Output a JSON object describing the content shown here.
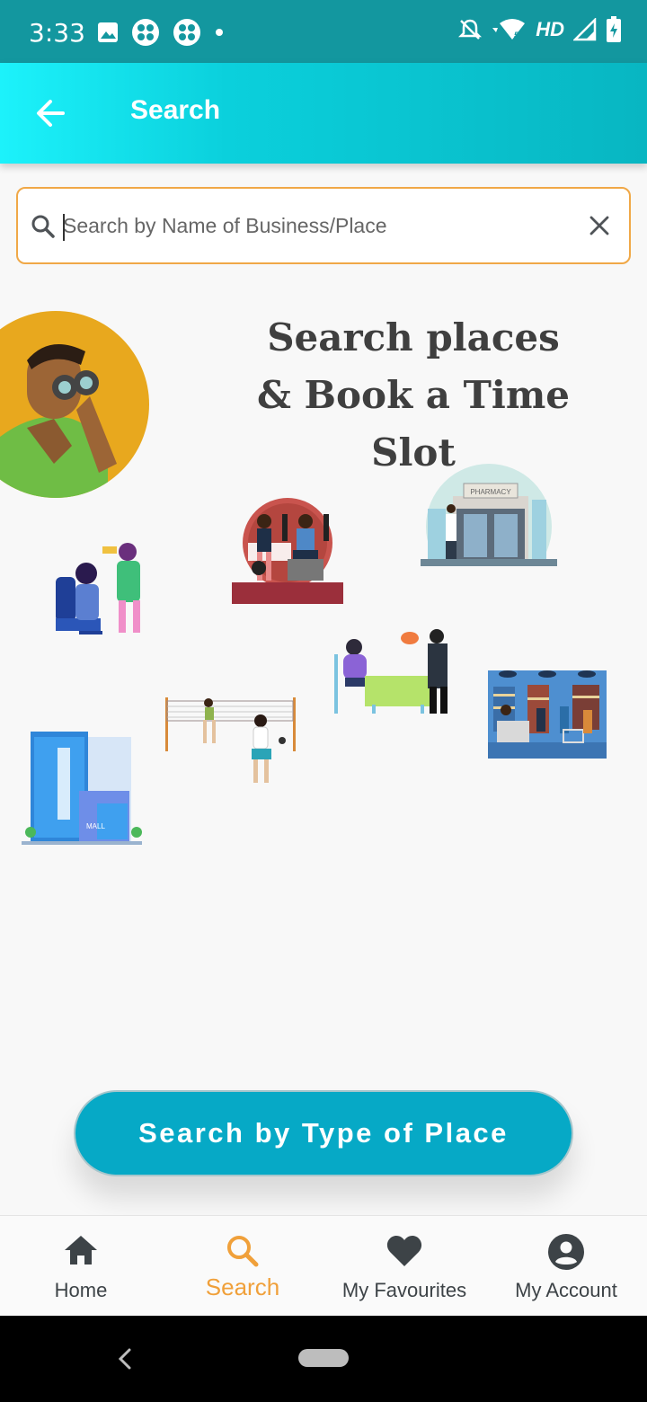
{
  "status_bar": {
    "time": "3:33",
    "network_label": "HD"
  },
  "app_bar": {
    "title": "Search"
  },
  "search": {
    "placeholder": "Search by Name of Business/Place",
    "value": ""
  },
  "headline": {
    "line1": "Search places",
    "line2": "& Book a Time Slot"
  },
  "illustrations": {
    "pharmacy_sign": "PHARMACY",
    "mall_sign": "MALL"
  },
  "action_button": {
    "label": "Search by Type of Place"
  },
  "bottom_nav": {
    "items": [
      {
        "label": "Home",
        "icon": "home-icon",
        "active": false
      },
      {
        "label": "Search",
        "icon": "search-icon",
        "active": true
      },
      {
        "label": "My Favourites",
        "icon": "heart-icon",
        "active": false
      },
      {
        "label": "My Account",
        "icon": "account-icon",
        "active": false
      }
    ]
  },
  "colors": {
    "status_bar": "#13979f",
    "app_bar_start": "#1cf2fb",
    "app_bar_end": "#08b6c2",
    "search_border": "#f0a847",
    "button": "#06a9c6",
    "active_nav": "#f0a03a"
  }
}
